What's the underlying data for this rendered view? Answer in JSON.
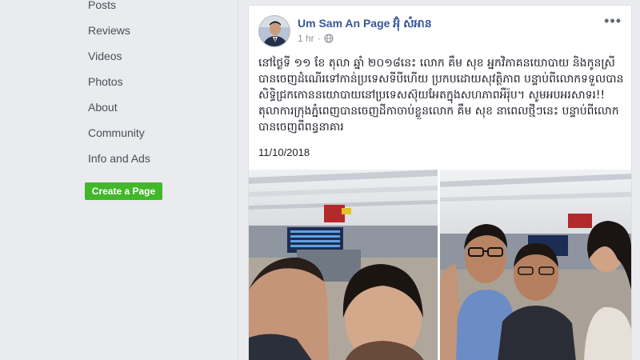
{
  "sidebar": {
    "items": [
      {
        "label": "Posts"
      },
      {
        "label": "Reviews"
      },
      {
        "label": "Videos"
      },
      {
        "label": "Photos"
      },
      {
        "label": "About"
      },
      {
        "label": "Community"
      },
      {
        "label": "Info and Ads"
      }
    ],
    "create_page_label": "Create a Page"
  },
  "post": {
    "page_name": "Um Sam An Page អ៊ុំ សំអាន",
    "time": "1 hr",
    "audience_icon": "globe-icon",
    "text": "នៅថ្ងៃទី ១១ ខែ តុលា ឆ្នាំ ២០១៨នេះ លោក គឹម សុខ អ្នកវិភាគនយោបាយ និងកូនស្រី បានចេញដំណើរទៅកាន់ប្រទេសទីបីហើយ ប្រកបដោយសុវត្ថិភាព បន្ទាប់ពីលោកទទួលបានសិទ្ធិជ្រកកោននយោបាយនៅប្រទេសស៊ុយអែតក្នុងសហភាពអឺរ៉ុប។ សូមអបអរសាទរ!! តុលាការក្រុងភ្នំពេញបានចេញដីកាចាប់ខ្លួនលោក គឹម សុខ នាពេលថ្មីៗនេះ បន្ទាប់ពីលោកបានចេញពីពន្ធនាគារ",
    "date": "11/10/2018"
  },
  "colors": {
    "page_bg": "#e9ebee",
    "link": "#365899",
    "create_button": "#42b72a"
  }
}
